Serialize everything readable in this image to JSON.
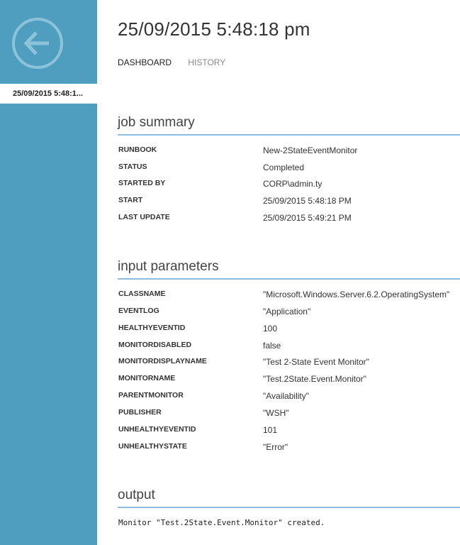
{
  "sidebar": {
    "selected_item": "25/09/2015 5:48:1..."
  },
  "header": {
    "title": "25/09/2015 5:48:18 pm",
    "tabs": [
      {
        "label": "DASHBOARD",
        "active": true
      },
      {
        "label": "HISTORY",
        "active": false
      }
    ]
  },
  "job_summary": {
    "title": "job summary",
    "rows": [
      {
        "label": "RUNBOOK",
        "value": "New-2StateEventMonitor"
      },
      {
        "label": "STATUS",
        "value": "Completed"
      },
      {
        "label": "STARTED BY",
        "value": "CORP\\admin.ty"
      },
      {
        "label": "START",
        "value": "25/09/2015 5:48:18 PM"
      },
      {
        "label": "LAST UPDATE",
        "value": "25/09/2015 5:49:21 PM"
      }
    ]
  },
  "input_parameters": {
    "title": "input parameters",
    "rows": [
      {
        "label": "CLASSNAME",
        "value": "\"Microsoft.Windows.Server.6.2.OperatingSystem\""
      },
      {
        "label": "EVENTLOG",
        "value": "\"Application\""
      },
      {
        "label": "HEALTHYEVENTID",
        "value": "100"
      },
      {
        "label": "MONITORDISABLED",
        "value": "false"
      },
      {
        "label": "MONITORDISPLAYNAME",
        "value": "\"Test 2-State Event Monitor\""
      },
      {
        "label": "MONITORNAME",
        "value": "\"Test.2State.Event.Monitor\""
      },
      {
        "label": "PARENTMONITOR",
        "value": "\"Availability\""
      },
      {
        "label": "PUBLISHER",
        "value": "\"WSH\""
      },
      {
        "label": "UNHEALTHYEVENTID",
        "value": "101"
      },
      {
        "label": "UNHEALTHYSTATE",
        "value": "\"Error\""
      }
    ]
  },
  "output": {
    "title": "output",
    "text": "Monitor \"Test.2State.Event.Monitor\" created."
  },
  "colors": {
    "sidebar": "#4f9ec0",
    "section_rule": "#8fbde0"
  }
}
